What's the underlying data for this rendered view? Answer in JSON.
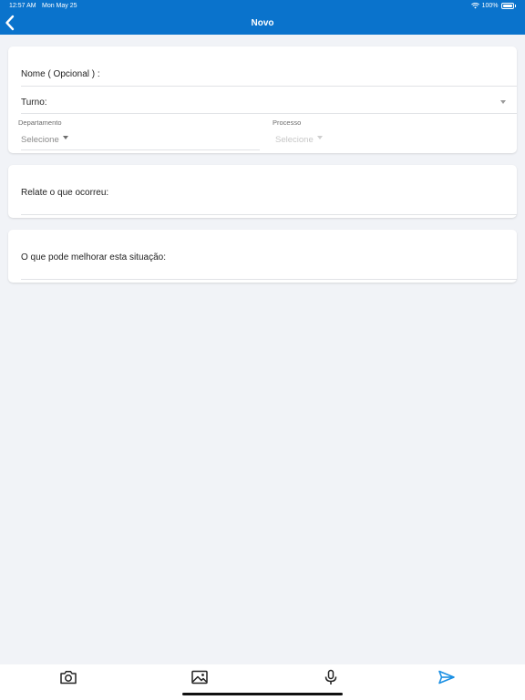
{
  "status_bar": {
    "time": "12:57 AM",
    "date": "Mon May 25",
    "battery": "100%"
  },
  "nav": {
    "title": "Novo"
  },
  "form": {
    "name_label": "Nome ( Opcional ) :",
    "shift_label": "Turno:",
    "department": {
      "label": "Departamento",
      "value": "Selecione"
    },
    "process": {
      "label": "Processo",
      "value": "Selecione"
    },
    "report_label": "Relate o que ocorreu:",
    "improve_label": "O que pode melhorar esta situação:"
  },
  "colors": {
    "header": "#0a73cc",
    "accent": "#1a8fe3",
    "background": "#f1f3f7"
  },
  "toolbar_icons": [
    "camera-icon",
    "image-icon",
    "microphone-icon",
    "send-icon"
  ]
}
